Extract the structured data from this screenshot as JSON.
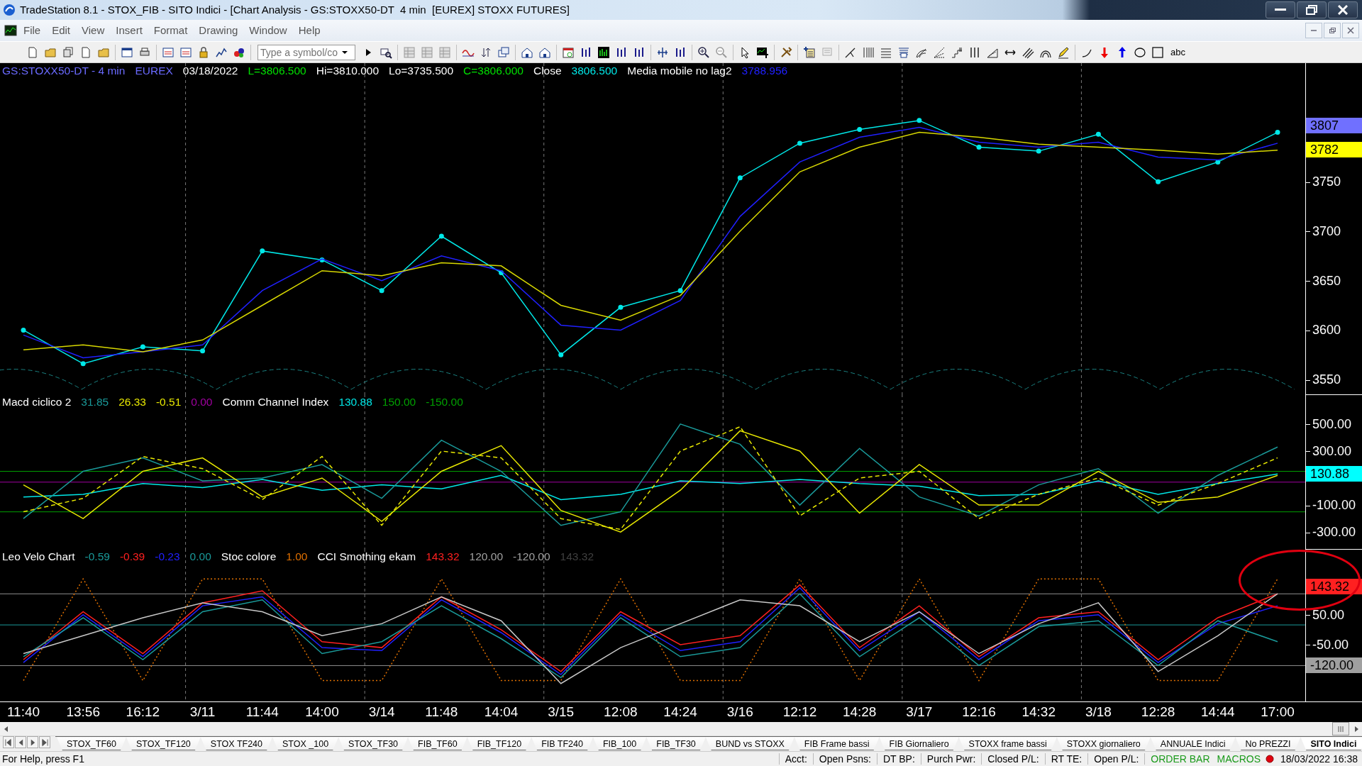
{
  "window": {
    "title": "TradeStation 8.1 - STOX_FIB - SITO Indici - [Chart Analysis - GS:STOXX50-DT  4 min  [EUREX] STOXX FUTURES]"
  },
  "menu": [
    "File",
    "Edit",
    "View",
    "Insert",
    "Format",
    "Drawing",
    "Window",
    "Help"
  ],
  "toolbar": {
    "symbol_field": {
      "placeholder": "Type a symbol/co"
    },
    "text_tool": "abc"
  },
  "panes": [
    {
      "marked": false,
      "legend": [
        {
          "text": "GS:STOXX50-DT - 4 min",
          "color": "#6a6aff"
        },
        {
          "text": "EUREX",
          "color": "#6a6aff"
        },
        {
          "text": "03/18/2022",
          "color": "#ffffff"
        },
        {
          "text": "L=3806.500",
          "color": "#00e000"
        },
        {
          "text": "Hi=3810.000",
          "color": "#ffffff"
        },
        {
          "text": "Lo=3735.500",
          "color": "#ffffff"
        },
        {
          "text": "C=3806.000",
          "color": "#00e000"
        },
        {
          "text": "Close",
          "color": "#ffffff"
        },
        {
          "text": "3806.500",
          "color": "#00e8e8"
        },
        {
          "text": "Media mobile no lag2",
          "color": "#ffffff"
        },
        {
          "text": "3788.956",
          "color": "#2020ff"
        }
      ],
      "badges": [
        {
          "text": "3807",
          "color": "#7070ff"
        },
        {
          "text": "3782",
          "color": "#ffff00"
        }
      ],
      "chart_data": {
        "type": "line",
        "categories": [
          null,
          null,
          null,
          null,
          null,
          null,
          null,
          null,
          null,
          null,
          null,
          null,
          null,
          null,
          null,
          null,
          null,
          null,
          null,
          null,
          null,
          null
        ],
        "ylim": [
          3535,
          3870
        ],
        "yticks": [
          3550,
          3600,
          3650,
          3700,
          3750
        ],
        "series": [
          {
            "color": "#00e8e8",
            "marker": "circle",
            "values": [
              3600,
              3566,
              3583,
              3579,
              3680,
              3671,
              3640,
              3695,
              3658,
              3575,
              3623,
              3640,
              3754,
              3789,
              3803,
              3812,
              3785,
              3781,
              3798,
              3750,
              3770,
              3800
            ]
          },
          {
            "color": "#2020ff",
            "values": [
              3595,
              3572,
              3578,
              3585,
              3640,
              3672,
              3650,
              3675,
              3660,
              3605,
              3600,
              3630,
              3715,
              3770,
              3795,
              3805,
              3790,
              3785,
              3790,
              3775,
              3772,
              3789
            ]
          },
          {
            "color": "#d8d800",
            "values": [
              3580,
              3585,
              3578,
              3590,
              3625,
              3660,
              3655,
              3668,
              3665,
              3625,
              3610,
              3635,
              3700,
              3760,
              3785,
              3800,
              3795,
              3788,
              3785,
              3782,
              3778,
              3782
            ]
          }
        ]
      }
    },
    {
      "marked": false,
      "legend": [
        {
          "text": "Macd ciclico 2",
          "color": "#ffffff"
        },
        {
          "text": "31.85",
          "color": "#1a9a9a"
        },
        {
          "text": "26.33",
          "color": "#e8e800"
        },
        {
          "text": "-0.51",
          "color": "#e8e800"
        },
        {
          "text": "0.00",
          "color": "#a000a0"
        },
        {
          "text": "Comm Channel Index",
          "color": "#ffffff"
        },
        {
          "text": "130.88",
          "color": "#00e8e8"
        },
        {
          "text": "150.00",
          "color": "#00a000"
        },
        {
          "text": "-150.00",
          "color": "#00a000"
        }
      ],
      "badges": [
        {
          "text": "130.88",
          "color": "#00ffff"
        }
      ],
      "chart_data": {
        "type": "line",
        "categories": [
          null,
          null,
          null,
          null,
          null,
          null,
          null,
          null,
          null,
          null,
          null,
          null,
          null,
          null,
          null,
          null,
          null,
          null,
          null,
          null,
          null,
          null
        ],
        "ylim": [
          -425,
          720
        ],
        "yticks": [
          {
            "value": 500,
            "label": "500.00"
          },
          {
            "value": 300,
            "label": "300.00"
          },
          {
            "value": -100,
            "label": "-100.00"
          },
          {
            "value": -300,
            "label": "-300.00"
          }
        ],
        "series": [
          {
            "color": "#00e8e8",
            "values": [
              -40,
              -20,
              60,
              30,
              90,
              10,
              50,
              20,
              120,
              -60,
              -20,
              80,
              60,
              90,
              60,
              40,
              -30,
              -20,
              80,
              -20,
              60,
              130
            ]
          },
          {
            "color": "#1a9a9a",
            "values": [
              -200,
              150,
              250,
              80,
              100,
              200,
              -50,
              380,
              150,
              -250,
              -150,
              500,
              350,
              -100,
              320,
              -40,
              -180,
              50,
              170,
              -160,
              120,
              330
            ]
          },
          {
            "color": "#e8e800",
            "line_style": "dashed",
            "values": [
              -150,
              -50,
              260,
              170,
              -60,
              260,
              -250,
              300,
              250,
              -200,
              -280,
              300,
              480,
              -180,
              100,
              150,
              -200,
              -20,
              100,
              -100,
              60,
              250
            ]
          },
          {
            "color": "#e8e800",
            "values": [
              50,
              -200,
              150,
              250,
              -40,
              100,
              -220,
              150,
              340,
              -140,
              -300,
              10,
              450,
              300,
              -160,
              200,
              -100,
              -100,
              150,
              -80,
              -40,
              120
            ]
          }
        ],
        "ref_lines": [
          {
            "axis": "y",
            "value": 150,
            "color": "#00a000"
          },
          {
            "axis": "y",
            "value": -150,
            "color": "#00a000"
          },
          {
            "axis": "y",
            "value": 70,
            "color": "#a000a0"
          }
        ]
      }
    },
    {
      "marked": true,
      "legend": [
        {
          "text": "Leo Velo Chart",
          "color": "#ffffff"
        },
        {
          "text": "-0.59",
          "color": "#1a9a9a"
        },
        {
          "text": "-0.39",
          "color": "#ff2020"
        },
        {
          "text": "-0.23",
          "color": "#2020ff"
        },
        {
          "text": "0.00",
          "color": "#1a9a9a"
        },
        {
          "text": "Stoc colore",
          "color": "#ffffff"
        },
        {
          "text": "1.00",
          "color": "#e07000"
        },
        {
          "text": "CCI Smothing ekam",
          "color": "#ffffff"
        },
        {
          "text": "143.32",
          "color": "#ff2020"
        },
        {
          "text": "120.00",
          "color": "#a0a0a0"
        },
        {
          "text": "-120.00",
          "color": "#a0a0a0"
        },
        {
          "text": "143.32",
          "color": "#404040"
        }
      ],
      "badges": [
        {
          "text": "143.32",
          "color": "#ff2020"
        },
        {
          "text": "-120.00",
          "color": "#a0a0a0"
        }
      ],
      "chart_data": {
        "type": "line",
        "categories": [
          null,
          null,
          null,
          null,
          null,
          null,
          null,
          null,
          null,
          null,
          null,
          null,
          null,
          null,
          null,
          null,
          null,
          null,
          null,
          null,
          null,
          null
        ],
        "ylim": [
          -240,
          270
        ],
        "yticks": [
          {
            "value": 50,
            "label": "50.00"
          },
          {
            "value": -50,
            "label": "-50.00"
          }
        ],
        "series": [
          {
            "color": "#e07000",
            "line_style": "dotted",
            "values": [
              -170,
              170,
              -170,
              170,
              170,
              -170,
              -170,
              170,
              -170,
              -170,
              170,
              -170,
              -170,
              170,
              -170,
              170,
              -170,
              170,
              170,
              -170,
              -170,
              170
            ]
          },
          {
            "color": "#ff2020",
            "values": [
              -100,
              60,
              -80,
              90,
              130,
              -40,
              -60,
              110,
              0,
              -140,
              60,
              -50,
              -20,
              150,
              -60,
              80,
              -90,
              40,
              60,
              -100,
              40,
              120
            ]
          },
          {
            "color": "#2020ff",
            "values": [
              -110,
              50,
              -90,
              80,
              110,
              -60,
              -70,
              100,
              -10,
              -150,
              50,
              -70,
              -40,
              140,
              -70,
              60,
              -100,
              30,
              50,
              -110,
              20,
              80
            ]
          },
          {
            "color": "#1a9a9a",
            "values": [
              -90,
              40,
              -100,
              60,
              100,
              -80,
              -40,
              80,
              -30,
              -160,
              40,
              -90,
              -60,
              120,
              -90,
              40,
              -120,
              10,
              30,
              -120,
              30,
              -40
            ]
          },
          {
            "color": "#c8c8c8",
            "values": [
              -80,
              -20,
              40,
              90,
              60,
              -20,
              20,
              110,
              30,
              -180,
              -60,
              20,
              100,
              80,
              -40,
              60,
              -80,
              20,
              90,
              -140,
              -20,
              120
            ]
          }
        ],
        "ref_lines": [
          {
            "axis": "y",
            "value": 120,
            "color": "#909090"
          },
          {
            "axis": "y",
            "value": -120,
            "color": "#909090"
          },
          {
            "axis": "y",
            "value": 16,
            "color": "#1a9a9a"
          }
        ]
      }
    }
  ],
  "time_axis": [
    {
      "label": "11:40",
      "day_start": false
    },
    {
      "label": "13:56",
      "day_start": false
    },
    {
      "label": "16:12",
      "day_start": false
    },
    {
      "label": "3/11",
      "day_start": true
    },
    {
      "label": "11:44",
      "day_start": false
    },
    {
      "label": "14:00",
      "day_start": false
    },
    {
      "label": "3/14",
      "day_start": true
    },
    {
      "label": "11:48",
      "day_start": false
    },
    {
      "label": "14:04",
      "day_start": false
    },
    {
      "label": "3/15",
      "day_start": true
    },
    {
      "label": "12:08",
      "day_start": false
    },
    {
      "label": "14:24",
      "day_start": false
    },
    {
      "label": "3/16",
      "day_start": true
    },
    {
      "label": "12:12",
      "day_start": false
    },
    {
      "label": "14:28",
      "day_start": false
    },
    {
      "label": "3/17",
      "day_start": true
    },
    {
      "label": "12:16",
      "day_start": false
    },
    {
      "label": "14:32",
      "day_start": false
    },
    {
      "label": "3/18",
      "day_start": true
    },
    {
      "label": "12:28",
      "day_start": false
    },
    {
      "label": "14:44",
      "day_start": false
    },
    {
      "label": "17:00",
      "day_start": false
    }
  ],
  "sheet_tabs": [
    {
      "label": "STOX_TF60",
      "selected": false
    },
    {
      "label": "STOX_TF120",
      "selected": false
    },
    {
      "label": "STOX TF240",
      "selected": false
    },
    {
      "label": "STOX _100",
      "selected": false
    },
    {
      "label": "STOX_TF30",
      "selected": false
    },
    {
      "label": "FIB_TF60",
      "selected": false
    },
    {
      "label": "FIB_TF120",
      "selected": false
    },
    {
      "label": "FIB TF240",
      "selected": false
    },
    {
      "label": "FIB_100",
      "selected": false
    },
    {
      "label": "FIB_TF30",
      "selected": false
    },
    {
      "label": "BUND vs STOXX",
      "selected": false
    },
    {
      "label": "FIB Frame bassi",
      "selected": false
    },
    {
      "label": "FIB Giornaliero",
      "selected": false
    },
    {
      "label": "STOXX frame bassi",
      "selected": false
    },
    {
      "label": "STOXX giornaliero",
      "selected": false
    },
    {
      "label": "ANNUALE Indici",
      "selected": false
    },
    {
      "label": "No PREZZI",
      "selected": false
    },
    {
      "label": "SITO Indici",
      "selected": true
    }
  ],
  "status_bar": {
    "help": "For Help, press F1",
    "fields": [
      "Acct:",
      "Open Psns:",
      "DT BP:",
      "Purch Pwr:",
      "Closed P/L:",
      "RT TE:",
      "Open P/L:"
    ],
    "order_bar": "ORDER BAR",
    "macros": "MACROS",
    "datetime": "18/03/2022 16:38"
  }
}
